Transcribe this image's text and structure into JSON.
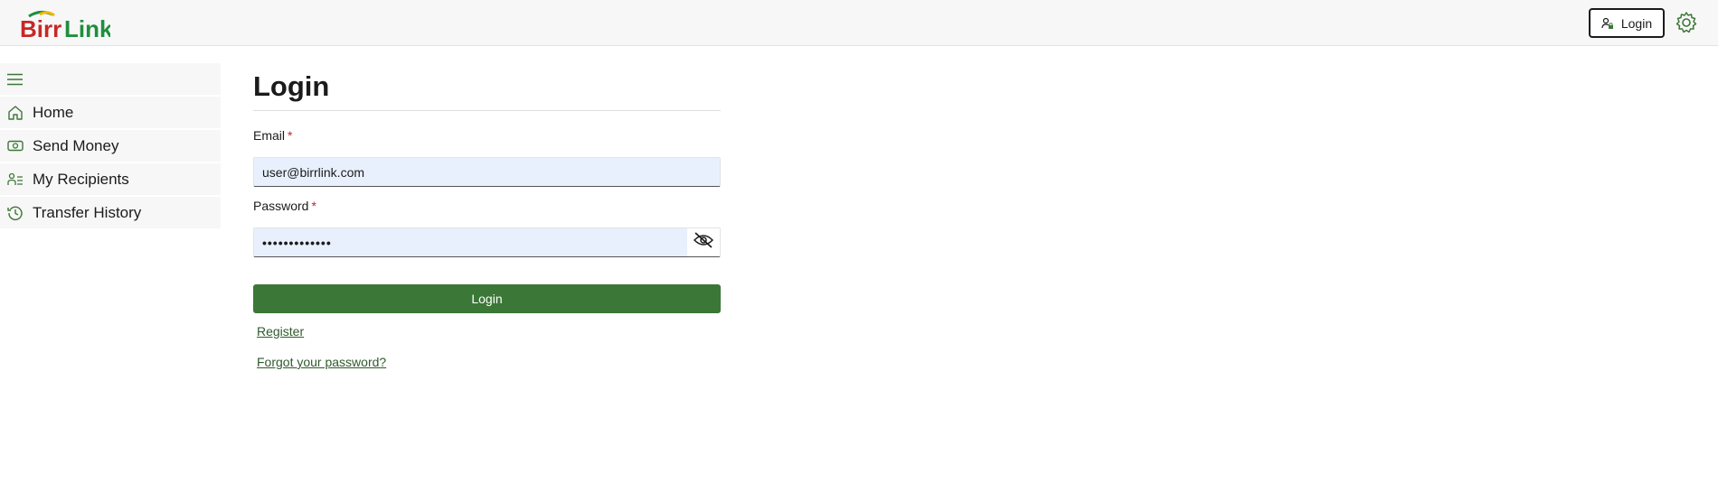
{
  "app": {
    "logo_text": "BirrLink",
    "brand_colors": {
      "primary_green": "#3b7736",
      "logo_red": "#c62828",
      "logo_green": "#1e8f3e",
      "logo_yellow": "#f2b705"
    }
  },
  "header": {
    "login_label": "Login",
    "login_icon": "lock-person-icon",
    "settings_icon": "gear-icon"
  },
  "sidebar": {
    "menu_icon": "hamburger-menu-icon",
    "items": [
      {
        "label": "Home",
        "icon": "home-icon"
      },
      {
        "label": "Send Money",
        "icon": "money-icon"
      },
      {
        "label": "My Recipients",
        "icon": "people-icon"
      },
      {
        "label": "Transfer History",
        "icon": "history-icon"
      }
    ]
  },
  "form": {
    "title": "Login",
    "email_label": "Email",
    "email_value": "user@birrlink.com",
    "password_label": "Password",
    "password_value": "•••••••••••••",
    "required_marker": "*",
    "toggle_icon": "eye-off-icon",
    "submit_label": "Login",
    "register_link": "Register",
    "forgot_link": "Forgot your password?"
  }
}
